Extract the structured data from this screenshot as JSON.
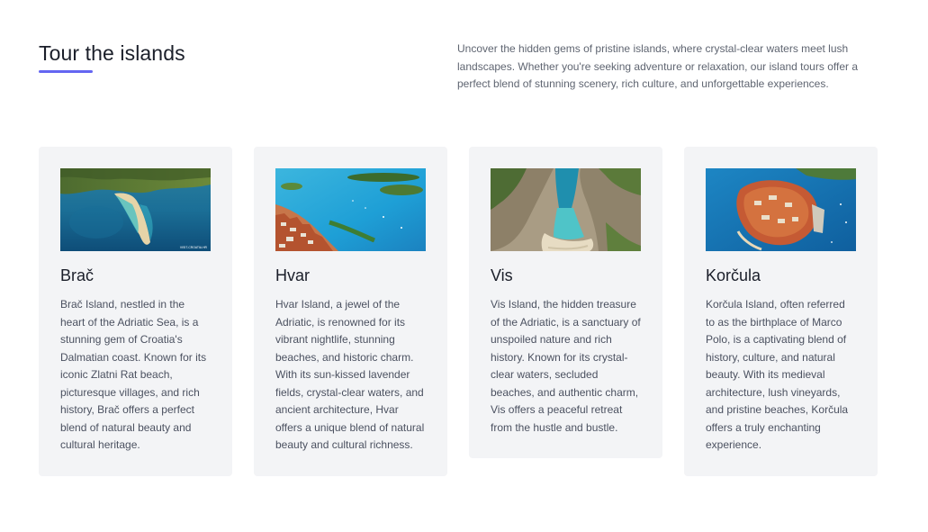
{
  "section": {
    "title": "Tour the islands",
    "intro": "Uncover the hidden gems of pristine islands, where crystal-clear waters meet lush landscapes. Whether you're seeking adventure or relaxation, our island tours offer a perfect blend of stunning scenery, rich culture, and unforgettable experiences.",
    "accent_color": "#6466f1"
  },
  "cards": [
    {
      "title": "Brač",
      "text": "Brač Island, nestled in the heart of the Adriatic Sea, is a stunning gem of Croatia's Dalmatian coast. Known for its iconic Zlatni Rat beach, picturesque villages, and rich history, Brač offers a perfect blend of natural beauty and cultural heritage.",
      "image": "brac-zlatni-rat-aerial-photo",
      "watermark": "VISIT-CROATIA.HR"
    },
    {
      "title": "Hvar",
      "text": "Hvar Island, a jewel of the Adriatic, is renowned for its vibrant nightlife, stunning beaches, and historic charm. With its sun-kissed lavender fields, crystal-clear waters, and ancient architecture, Hvar offers a unique blend of natural beauty and cultural richness.",
      "image": "hvar-harbor-aerial-photo"
    },
    {
      "title": "Vis",
      "text": "Vis Island, the hidden treasure of the Adriatic, is a sanctuary of unspoiled nature and rich history. Known for its crystal-clear waters, secluded beaches, and authentic charm, Vis offers a peaceful retreat from the hustle and bustle.",
      "image": "vis-cove-beach-aerial-photo"
    },
    {
      "title": "Korčula",
      "text": "Korčula Island, often referred to as the birthplace of Marco Polo, is a captivating blend of history, culture, and natural beauty. With its medieval architecture, lush vineyards, and pristine beaches, Korčula offers a truly enchanting experience.",
      "image": "korcula-old-town-aerial-photo"
    }
  ]
}
